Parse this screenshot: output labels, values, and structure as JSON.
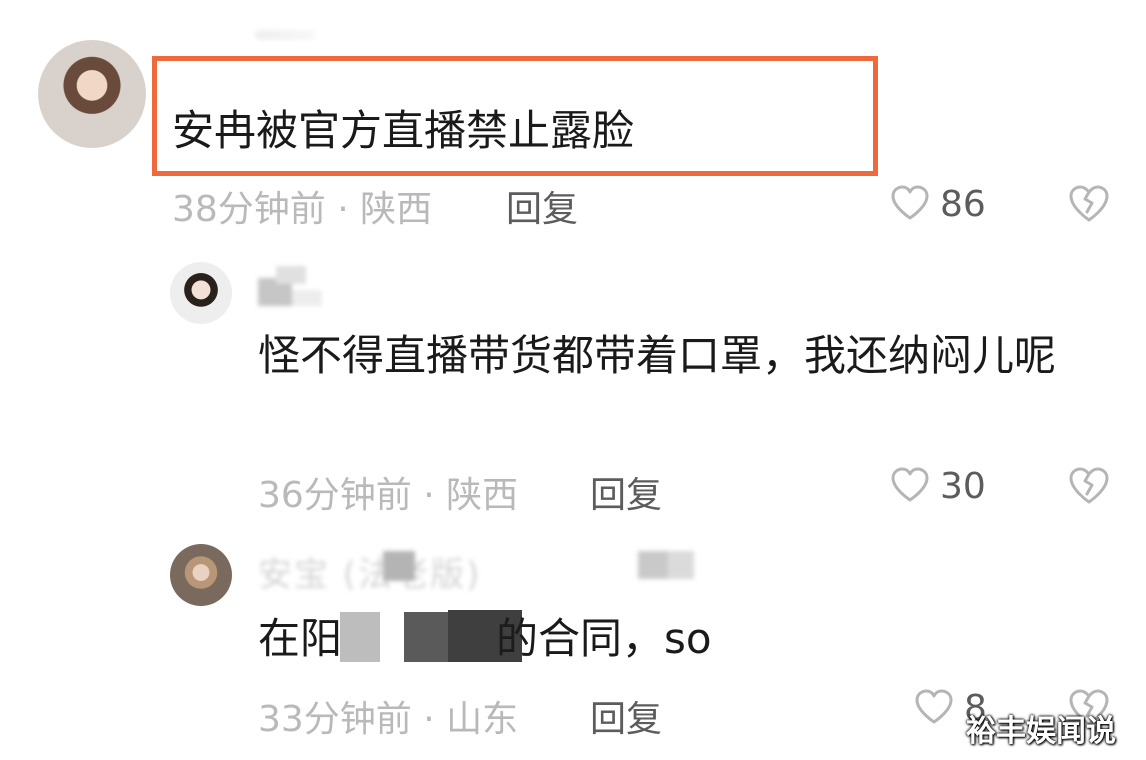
{
  "comments": [
    {
      "text": "安冉被官方直播禁止露脸",
      "meta": "38分钟前 · 陕西",
      "reply": "回复",
      "likes": "86"
    },
    {
      "text": "怪不得直播带货都带着口罩，我还纳闷儿呢",
      "meta": "36分钟前 · 陕西",
      "reply": "回复",
      "likes": "30"
    },
    {
      "text_start": "在阳",
      "text_end": "的合同，so",
      "meta": "33分钟前 · 山东",
      "reply": "回复",
      "likes": "8",
      "name_partial": "安宝 (法老版)"
    }
  ],
  "watermark": "裕丰娱闻说",
  "highlight_color": "#ee6a3d",
  "icons": [
    "heart-outline-icon",
    "broken-heart-icon",
    "avatar"
  ]
}
